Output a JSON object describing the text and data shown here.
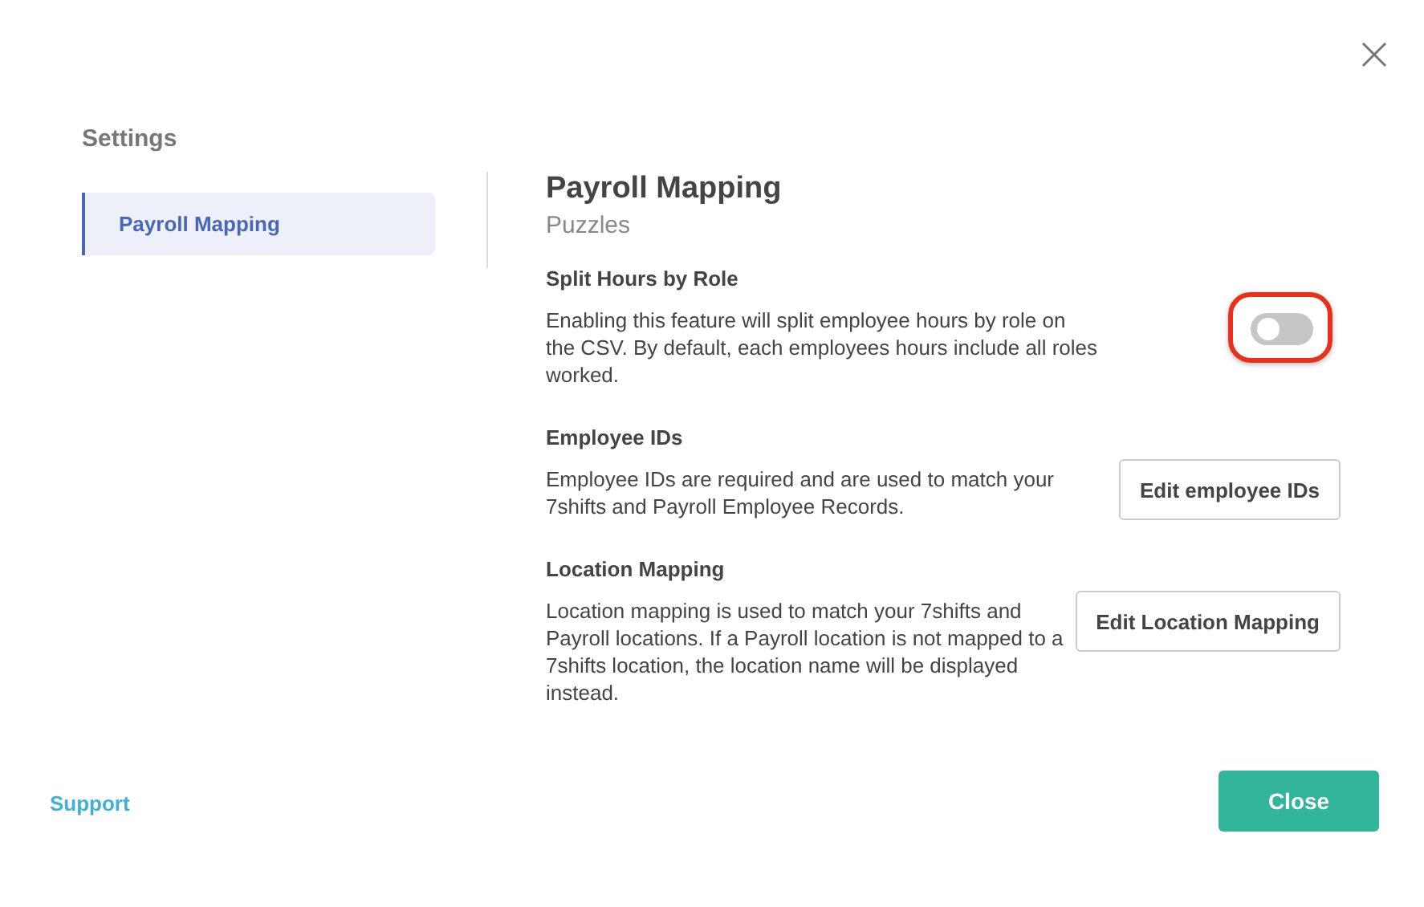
{
  "sidebar": {
    "title": "Settings",
    "items": [
      {
        "label": "Payroll Mapping",
        "selected": true
      }
    ]
  },
  "main": {
    "title": "Payroll Mapping",
    "subtitle": "Puzzles",
    "sections": [
      {
        "kind": "toggle",
        "heading": "Split Hours by Role",
        "text": "Enabling this feature will split employee hours by role on the CSV. By default, each employees hours include all roles worked.",
        "on": false,
        "highlighted": true
      },
      {
        "kind": "button",
        "heading": "Employee IDs",
        "text": "Employee IDs are required and are used to match your 7shifts and Payroll Employee Records.",
        "button": "Edit employee IDs"
      },
      {
        "kind": "button",
        "heading": "Location Mapping",
        "text": "Location mapping is used to match your 7shifts and Payroll locations. If a Payroll location is not mapped to a 7shifts location, the location name will be displayed instead.",
        "button": "Edit Location Mapping"
      }
    ]
  },
  "footer": {
    "link": "Support",
    "button": "Close"
  }
}
